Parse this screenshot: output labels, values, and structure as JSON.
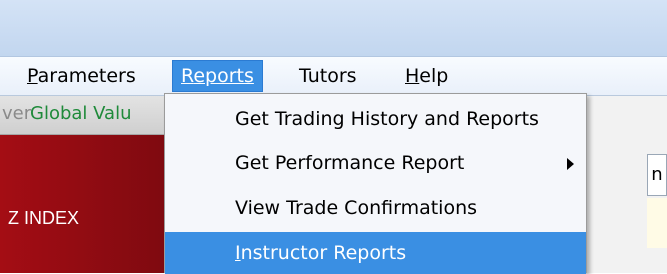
{
  "menubar": {
    "items": [
      {
        "label": "Parameters",
        "mnemonic": "P",
        "rest": "arameters"
      },
      {
        "label": "Reports",
        "mnemonic": "R",
        "rest": "eports"
      },
      {
        "label": "Tutors",
        "mnemonic": "",
        "rest": "Tutors"
      },
      {
        "label": "Help",
        "mnemonic": "H",
        "rest": "elp"
      }
    ]
  },
  "toolbar": {
    "ver_text": "ver",
    "global_value_text": "Global Valu"
  },
  "panel": {
    "label": "Z INDEX"
  },
  "right_strip": {
    "cell_text": "n"
  },
  "reports_menu": {
    "items": [
      {
        "label": "Get Trading History and Reports"
      },
      {
        "label": "Get Performance Report",
        "has_submenu": true
      },
      {
        "label": "View Trade Confirmations"
      },
      {
        "label": "Instructor Reports",
        "mnemonic": "I",
        "rest": "nstructor Reports",
        "highlighted": true
      }
    ]
  },
  "colors": {
    "highlight": "#3a8fe3",
    "panel_red": "#a40d14",
    "global_value_green": "#1f8a3a"
  }
}
